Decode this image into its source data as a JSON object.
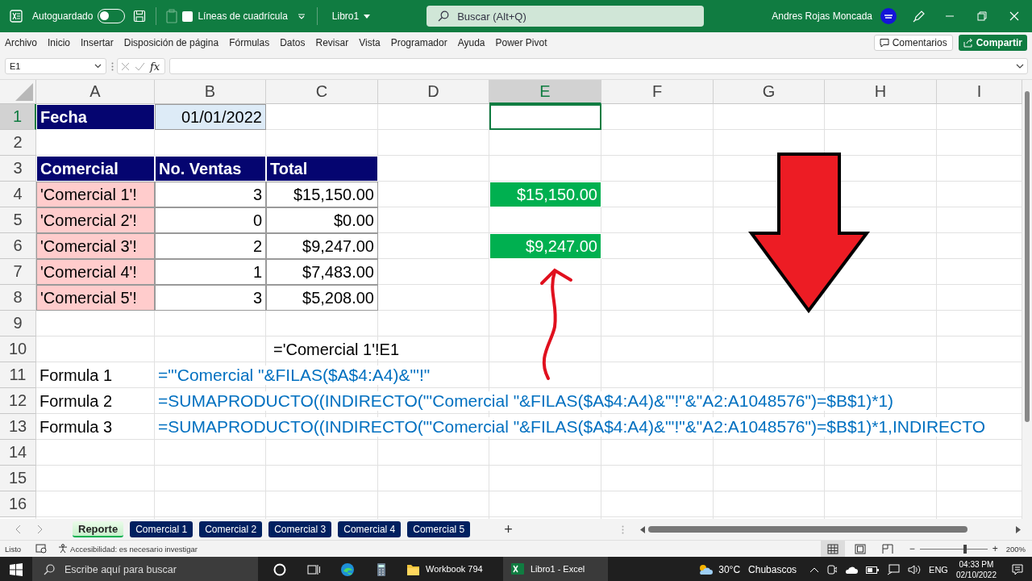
{
  "title_bar": {
    "autosave_label": "Autoguardado",
    "autosave_on": false,
    "gridlines_label": "Líneas de cuadrícula",
    "gridlines_checked": false,
    "file_name": "Libro1",
    "search_placeholder": "Buscar (Alt+Q)",
    "user_name": "Andres Rojas Moncada"
  },
  "ribbon_tabs": [
    "Archivo",
    "Inicio",
    "Insertar",
    "Disposición de página",
    "Fórmulas",
    "Datos",
    "Revisar",
    "Vista",
    "Programador",
    "Ayuda",
    "Power Pivot"
  ],
  "ribbon_buttons": [
    {
      "label": "Comentarios",
      "kind": "comments"
    },
    {
      "label": "Compartir",
      "kind": "share"
    }
  ],
  "formula_bar": {
    "name_box": "E1",
    "fx": "fx"
  },
  "sheet": {
    "columns": [
      {
        "label": "A",
        "selected": false
      },
      {
        "label": "B",
        "selected": false
      },
      {
        "label": "C",
        "selected": false
      },
      {
        "label": "D",
        "selected": false
      },
      {
        "label": "E",
        "selected": true
      },
      {
        "label": "F",
        "selected": false
      },
      {
        "label": "G",
        "selected": false
      },
      {
        "label": "H",
        "selected": false
      },
      {
        "label": "I",
        "selected": false
      }
    ],
    "rows": [
      {
        "number": "1",
        "selected": true,
        "cells": {
          "A": {
            "kind": "label",
            "text": "Fecha"
          },
          "B": {
            "kind": "date",
            "text": "01/01/2022"
          }
        }
      },
      {
        "number": "2",
        "selected": false
      },
      {
        "number": "3",
        "selected": false,
        "cells": {
          "A": {
            "kind": "header",
            "text": "Comercial"
          },
          "B": {
            "kind": "header",
            "text": "No. Ventas"
          },
          "C": {
            "kind": "header",
            "text": "Total"
          }
        }
      },
      {
        "number": "4",
        "selected": false,
        "cells": {
          "A": {
            "kind": "name",
            "text": "'Comercial 1'!"
          },
          "B": {
            "kind": "number",
            "text": "3"
          },
          "C": {
            "kind": "number",
            "text": "$15,150.00"
          },
          "E": {
            "kind": "result",
            "text": "$15,150.00"
          }
        }
      },
      {
        "number": "5",
        "selected": false,
        "cells": {
          "A": {
            "kind": "name",
            "text": "'Comercial 2'!"
          },
          "B": {
            "kind": "number",
            "text": "0"
          },
          "C": {
            "kind": "number",
            "text": "$0.00"
          }
        }
      },
      {
        "number": "6",
        "selected": false,
        "cells": {
          "A": {
            "kind": "name",
            "text": "'Comercial 3'!"
          },
          "B": {
            "kind": "number",
            "text": "2"
          },
          "C": {
            "kind": "number",
            "text": "$9,247.00"
          },
          "E": {
            "kind": "result",
            "text": "$9,247.00"
          }
        }
      },
      {
        "number": "7",
        "selected": false,
        "cells": {
          "A": {
            "kind": "name",
            "text": "'Comercial 4'!"
          },
          "B": {
            "kind": "number",
            "text": "1"
          },
          "C": {
            "kind": "number",
            "text": "$7,483.00"
          }
        }
      },
      {
        "number": "8",
        "selected": false,
        "cells": {
          "A": {
            "kind": "name",
            "text": "'Comercial 5'!"
          },
          "B": {
            "kind": "number",
            "text": "3"
          },
          "C": {
            "kind": "number",
            "text": "$5,208.00"
          }
        }
      },
      {
        "number": "9",
        "selected": false
      },
      {
        "number": "10",
        "selected": false,
        "cells": {
          "C": {
            "kind": "note",
            "text": "='Comercial 1'!E1"
          }
        }
      },
      {
        "number": "11",
        "selected": false,
        "cells": {
          "A": {
            "kind": "plain",
            "text": "Formula 1"
          },
          "B": {
            "kind": "formula",
            "text": "=\"'Comercial \"&FILAS($A$4:A4)&\"'!\""
          }
        }
      },
      {
        "number": "12",
        "selected": false,
        "cells": {
          "A": {
            "kind": "plain",
            "text": "Formula 2"
          },
          "B": {
            "kind": "formula",
            "text": "=SUMAPRODUCTO((INDIRECTO(\"'Comercial \"&FILAS($A$4:A4)&\"'!\"&\"A2:A1048576\")=$B$1)*1)"
          }
        }
      },
      {
        "number": "13",
        "selected": false,
        "cells": {
          "A": {
            "kind": "plain",
            "text": "Formula 3"
          },
          "B": {
            "kind": "formula",
            "text": "=SUMAPRODUCTO((INDIRECTO(\"'Comercial \"&FILAS($A$4:A4)&\"'!\"&\"A2:A1048576\")=$B$1)*1,INDIRECTO"
          }
        }
      },
      {
        "number": "14",
        "selected": false
      },
      {
        "number": "15",
        "selected": false
      },
      {
        "number": "16",
        "selected": false
      }
    ]
  },
  "sheet_tabs": [
    {
      "label": "Reporte",
      "selected": true,
      "color": "#00b050"
    },
    {
      "label": "Comercial 1",
      "selected": false,
      "color": "#002060"
    },
    {
      "label": "Comercial 2",
      "selected": false,
      "color": "#002060"
    },
    {
      "label": "Comercial 3",
      "selected": false,
      "color": "#002060"
    },
    {
      "label": "Comercial 4",
      "selected": false,
      "color": "#002060"
    },
    {
      "label": "Comercial 5",
      "selected": false,
      "color": "#002060"
    }
  ],
  "add_sheet": "+",
  "status_bar": {
    "ready": "Listo",
    "accessibility": "Accesibilidad: es necesario investigar",
    "views": [
      {
        "kind": "normal",
        "selected": true
      },
      {
        "kind": "layout",
        "selected": false
      },
      {
        "kind": "pagebreak",
        "selected": false
      }
    ],
    "zoom_out": "−",
    "zoom_in": "+",
    "zoom_slider": {
      "level": 0.67
    },
    "zoom": "200%"
  },
  "taskbar": {
    "search_placeholder": "Escribe aquí para buscar",
    "apps": [
      {
        "kind": "explorer",
        "label": "Workbook 794",
        "selected": false
      },
      {
        "kind": "excel",
        "label": "Libro1 - Excel",
        "selected": true
      }
    ],
    "temperature": "30°C",
    "weather": "Chubascos",
    "language": "ENG",
    "time": "04:33 PM",
    "date": "02/10/2022"
  }
}
